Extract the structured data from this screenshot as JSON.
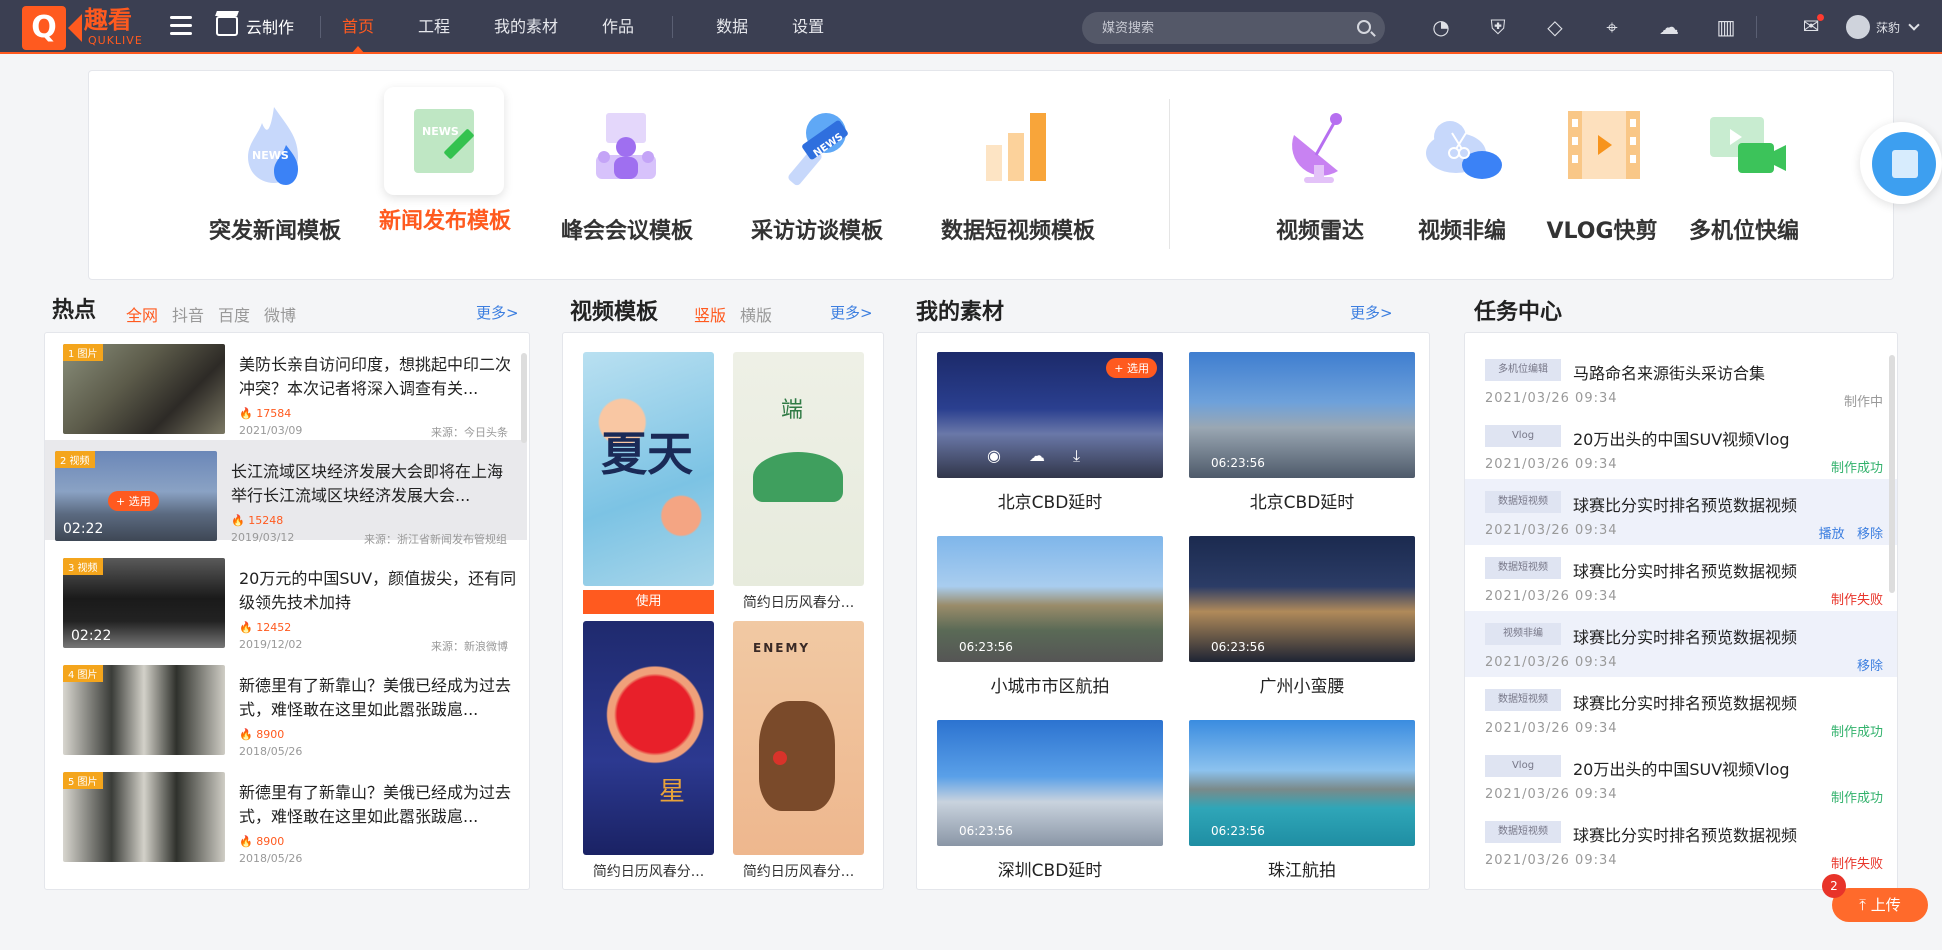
{
  "app": {
    "logo_cn": "趣看",
    "logo_en": "QUKLIVE",
    "cloud_make": "云制作"
  },
  "nav": {
    "items": [
      "首页",
      "工程",
      "我的素材",
      "作品",
      "数据",
      "设置"
    ],
    "active": 0
  },
  "search": {
    "placeholder": "媒资搜索"
  },
  "tools": [
    "recorder-icon",
    "shield-icon",
    "link-icon",
    "map-pin-icon",
    "cloud-upload-icon",
    "building-icon"
  ],
  "user": {
    "name": "莯豹"
  },
  "features": [
    {
      "label": "突发新闻模板",
      "icon": "fire-news-icon",
      "active": false
    },
    {
      "label": "新闻发布模板",
      "icon": "news-edit-icon",
      "active": true
    },
    {
      "label": "峰会会议模板",
      "icon": "meeting-icon",
      "active": false
    },
    {
      "label": "采访访谈模板",
      "icon": "microphone-icon",
      "active": false
    },
    {
      "label": "数据短视频模板",
      "icon": "bar-chart-icon",
      "active": false
    },
    {
      "label": "视频雷达",
      "icon": "radar-icon",
      "active": false
    },
    {
      "label": "视频非编",
      "icon": "cloud-scissors-icon",
      "active": false
    },
    {
      "label": "VLOG快剪",
      "icon": "film-icon",
      "active": false
    },
    {
      "label": "多机位快编",
      "icon": "multi-camera-icon",
      "active": false
    }
  ],
  "hot": {
    "title": "热点",
    "tabs": [
      "全网",
      "抖音",
      "百度",
      "微博"
    ],
    "active_tab": 0,
    "more": "更多>",
    "items": [
      {
        "badge": "1 图片",
        "title": "美防长亲自访问印度，想挑起中印二次冲突？本次记者将深入调查有关...",
        "heat": "17584",
        "date": "2021/03/09",
        "source": "来源：今日头条",
        "duration": "",
        "select": ""
      },
      {
        "badge": "2 视频",
        "title": "长江流域区块经济发展大会即将在上海举行长江流域区块经济发展大会...",
        "heat": "15248",
        "date": "2019/03/12",
        "source": "来源：浙江省新闻发布管规组",
        "duration": "02:22",
        "select": "+ 选用"
      },
      {
        "badge": "3 视频",
        "title": "20万元的中国SUV，颜值拔尖，还有同级领先技术加持",
        "heat": "12452",
        "date": "2019/12/02",
        "source": "来源：新浪微博",
        "duration": "02:22",
        "select": ""
      },
      {
        "badge": "4 图片",
        "title": "新德里有了新靠山？美俄已经成为过去式，难怪敢在这里如此嚣张跋扈...",
        "heat": "8900",
        "date": "2018/05/26",
        "source": "",
        "duration": "",
        "select": ""
      },
      {
        "badge": "5 图片",
        "title": "新德里有了新靠山？美俄已经成为过去式，难怪敢在这里如此嚣张跋扈...",
        "heat": "8900",
        "date": "2018/05/26",
        "source": "",
        "duration": "",
        "select": ""
      }
    ]
  },
  "templates": {
    "title": "视频模板",
    "tabs": [
      "竖版",
      "横版"
    ],
    "active_tab": 0,
    "more": "更多>",
    "use_label": "使用",
    "items": [
      {
        "label": "",
        "use": true
      },
      {
        "label": "简约日历风春分...",
        "use": false
      },
      {
        "label": "简约日历风春分...",
        "use": false
      },
      {
        "label": "简约日历风春分...",
        "use": false
      }
    ]
  },
  "materials": {
    "title": "我的素材",
    "more": "更多>",
    "select": "+ 选用",
    "items": [
      {
        "label": "北京CBD延时",
        "duration": ""
      },
      {
        "label": "北京CBD延时",
        "duration": "06:23:56"
      },
      {
        "label": "小城市市区航拍",
        "duration": "06:23:56"
      },
      {
        "label": "广州小蛮腰",
        "duration": "06:23:56"
      },
      {
        "label": "深圳CBD延时",
        "duration": "06:23:56"
      },
      {
        "label": "珠江航拍",
        "duration": "06:23:56"
      }
    ]
  },
  "tasks": {
    "title": "任务中心",
    "items": [
      {
        "tag": "多机位编辑",
        "title": "马路命名来源街头采访合集",
        "time": "2021/03/26   09:34",
        "status": "制作中",
        "kind": "doing"
      },
      {
        "tag": "Vlog",
        "title": "20万出头的中国SUV视频Vlog",
        "time": "2021/03/26   09:34",
        "status": "制作成功",
        "kind": "ok"
      },
      {
        "tag": "数据短视频",
        "title": "球赛比分实时排名预览数据视频",
        "time": "2021/03/26   09:34",
        "status": "播放   移除",
        "kind": "act"
      },
      {
        "tag": "数据短视频",
        "title": "球赛比分实时排名预览数据视频",
        "time": "2021/03/26   09:34",
        "status": "制作失败",
        "kind": "fail"
      },
      {
        "tag": "视频非编",
        "title": "球赛比分实时排名预览数据视频",
        "time": "2021/03/26   09:34",
        "status": "移除",
        "kind": "act"
      },
      {
        "tag": "数据短视频",
        "title": "球赛比分实时排名预览数据视频",
        "time": "2021/03/26   09:34",
        "status": "制作成功",
        "kind": "ok"
      },
      {
        "tag": "Vlog",
        "title": "20万出头的中国SUV视频Vlog",
        "time": "2021/03/26   09:34",
        "status": "制作成功",
        "kind": "ok"
      },
      {
        "tag": "数据短视频",
        "title": "球赛比分实时排名预览数据视频",
        "time": "2021/03/26   09:34",
        "status": "制作失败",
        "kind": "fail"
      }
    ]
  },
  "upload": {
    "label": "上传",
    "badge": "2"
  }
}
